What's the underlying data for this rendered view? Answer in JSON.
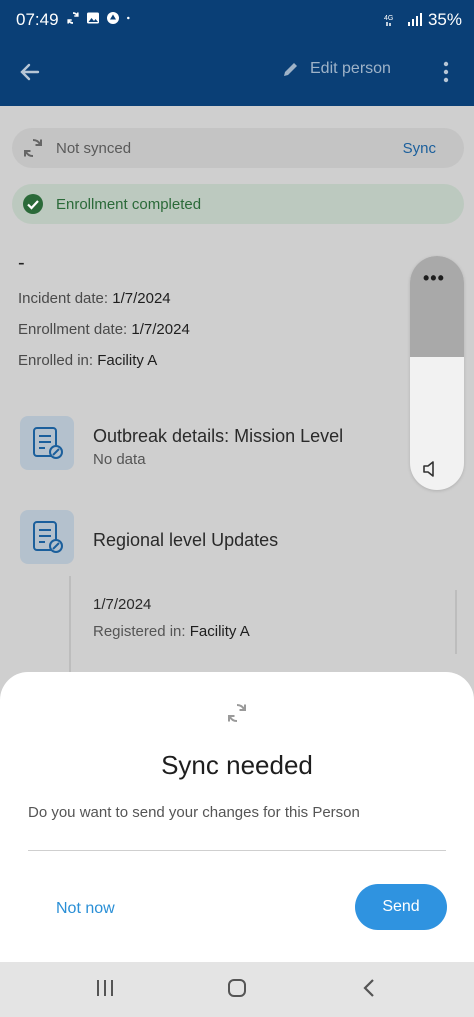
{
  "status_bar": {
    "time": "07:49",
    "battery": "35%",
    "network": "4G"
  },
  "app_bar": {
    "edit_label": "Edit person"
  },
  "sync_status": {
    "label": "Not synced",
    "action": "Sync"
  },
  "enrollment_status": {
    "label": "Enrollment completed"
  },
  "person": {
    "name": "-",
    "incident_date_label": "Incident date:",
    "incident_date": "1/7/2024",
    "enrollment_date_label": "Enrollment date:",
    "enrollment_date": "1/7/2024",
    "enrolled_in_label": "Enrolled in:",
    "enrolled_in": "Facility A"
  },
  "sections": [
    {
      "title": "Outbreak details: Mission Level",
      "subtitle": "No data"
    },
    {
      "title": "Regional level  Updates",
      "event_date": "1/7/2024",
      "registered_label": "Registered in:",
      "registered_value": "Facility A"
    }
  ],
  "volume_panel": {
    "more": "•••",
    "level": 0.57
  },
  "dialog": {
    "title": "Sync needed",
    "message": "Do you want to send your changes for this Person",
    "secondary_button": "Not now",
    "primary_button": "Send"
  },
  "colors": {
    "app_bar": "#0a3f76",
    "accent": "#2f93e0",
    "enroll_green": "#2b6a39"
  }
}
